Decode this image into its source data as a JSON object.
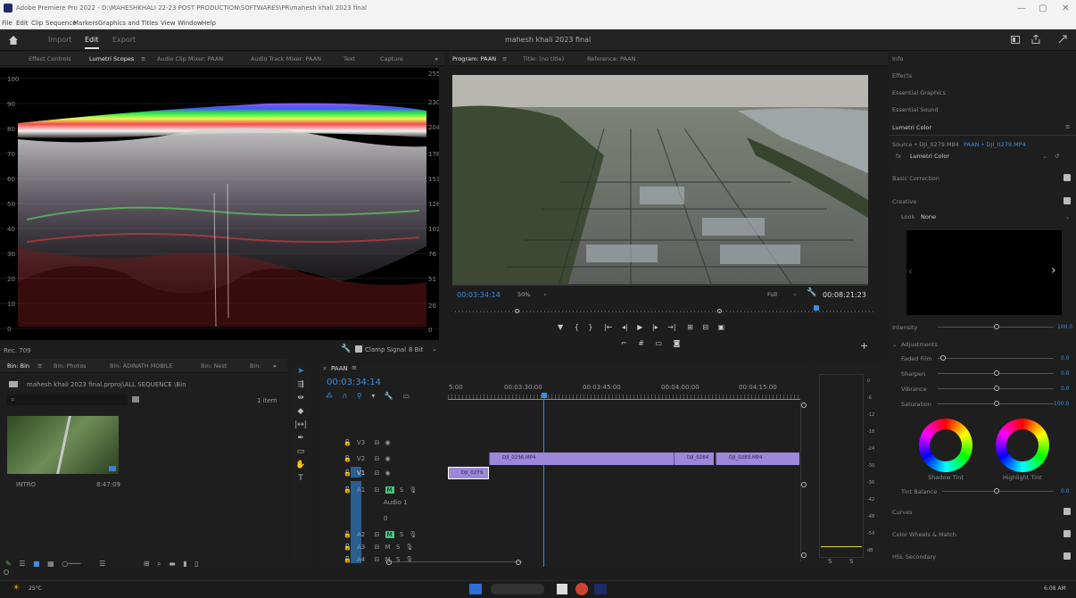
{
  "window": {
    "title": "Adobe Premiere Pro 2022 - D:\\MAHESHKHALI 22-23 POST PRODUCTION\\SOFTWARES\\PR\\mahesh khali 2023 final",
    "controls": [
      "—",
      "▢",
      "✕"
    ]
  },
  "menu": [
    "File",
    "Edit",
    "Clip",
    "Sequence",
    "Markers",
    "Graphics and Titles",
    "View",
    "Window",
    "Help"
  ],
  "header": {
    "workspaces": [
      "Import",
      "Edit",
      "Export"
    ],
    "active": "Edit",
    "project_title": "mahesh khali 2023 final"
  },
  "source_panel": {
    "tabs": [
      "Effect Controls",
      "Lumetri Scopes",
      "Audio Clip Mixer: PAAN",
      "Audio Track Mixer: PAAN",
      "Text",
      "Capture"
    ],
    "active": "Lumetri Scopes",
    "left_scale": [
      "100",
      "90",
      "80",
      "70",
      "60",
      "50",
      "40",
      "30",
      "20",
      "10",
      "0"
    ],
    "right_scale": [
      "255",
      "230",
      "204",
      "178",
      "153",
      "128",
      "102",
      "76",
      "51",
      "26",
      "0"
    ],
    "rec": "Rec. 709",
    "clamp": "Clamp Signal",
    "bitdepth": "8 Bit"
  },
  "program": {
    "tabs": [
      "Program: PAAN",
      "Title: (no title)",
      "Reference: PAAN"
    ],
    "timecode": "00:03:34:14",
    "zoom": "50%",
    "quality": "Full",
    "duration": "00:08:21:23"
  },
  "bins": {
    "tabs": [
      "Bin: Bin",
      "Bin: Photos",
      "Bin: ADINATH MOBILE",
      "Bin: Nest",
      "Bin:"
    ],
    "path": "mahesh khali 2023 final.prproj\\ALL SEQUENCE \\Bin",
    "count": "1 item",
    "clip_name": "INTRO",
    "clip_duration": "8:47:09"
  },
  "timeline": {
    "tab": "PAAN",
    "timecode": "00:03:34:14",
    "ruler": [
      "5:00",
      "00:03:30:00",
      "00:03:45:00",
      "00:04:00:00",
      "00:04:15:00"
    ],
    "video_tracks": [
      "V3",
      "V2",
      "V1"
    ],
    "audio_tracks": [
      "A1",
      "A2",
      "A3",
      "A4"
    ],
    "audio1_name": "Audio 1",
    "clips": [
      "DJI_0236.MP4",
      "DJI_0284",
      "DJI_0283.MP4",
      "DJI_0279"
    ],
    "track_buttons": {
      "toggle": "⊟",
      "eye": "◉",
      "mute": "M",
      "solo": "S"
    },
    "audio1_vol": "0"
  },
  "meter": {
    "scale": [
      "0",
      "-6",
      "-12",
      "-18",
      "-24",
      "-30",
      "-36",
      "-42",
      "-48",
      "-54",
      "dB"
    ],
    "solo": [
      "S",
      "S"
    ]
  },
  "lumetri": {
    "panels": [
      "Info",
      "Effects",
      "Essential Graphics",
      "Essential Sound",
      "Lumetri Color"
    ],
    "source": "Source • DJI_0279.MP4",
    "seq": "PAAN • DJI_0279.MP4",
    "effect": "Lumetri Color",
    "sections": {
      "basic": "Basic Correction",
      "creative": "Creative",
      "curves": "Curves",
      "wheels": "Color Wheels & Match",
      "hsl": "HSL Secondary"
    },
    "look_label": "Look",
    "look_value": "None",
    "intensity_label": "Intensity",
    "intensity": "100.0",
    "adjustments": "Adjustments",
    "faded": "Faded Film",
    "faded_val": "0.0",
    "sharpen": "Sharpen",
    "sharpen_val": "0.0",
    "vibrance": "Vibrance",
    "vibrance_val": "0.0",
    "saturation": "Saturation",
    "saturation_val": "100.0",
    "shadow_tint": "Shadow Tint",
    "highlight_tint": "Highlight Tint",
    "tint_balance": "Tint Balance",
    "tint_val": "0.0"
  },
  "taskbar": {
    "weather": "25°C",
    "time": "6:08 AM"
  }
}
